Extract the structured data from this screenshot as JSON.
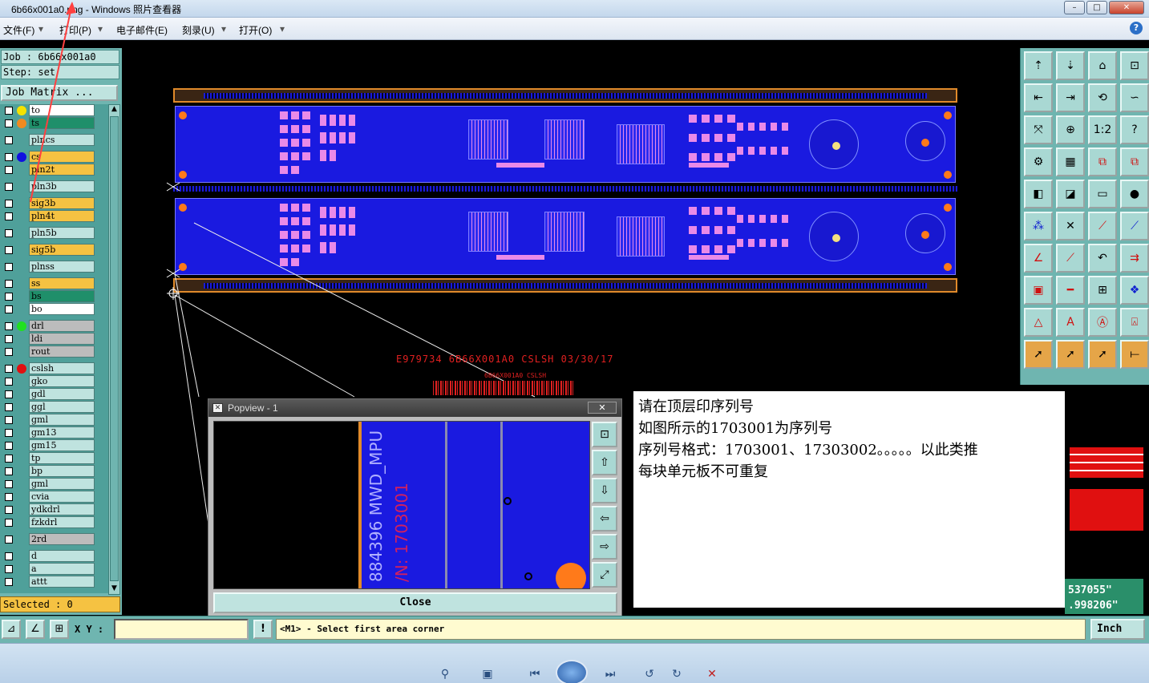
{
  "window": {
    "title": "6b66x001a0.png - Windows 照片查看器",
    "controls": [
      "–",
      "□",
      "✕"
    ]
  },
  "menu": {
    "file": "文件(F)",
    "print": "打印(P)",
    "email": "电子邮件(E)",
    "burn": "刻录(U)",
    "open": "打开(O)",
    "help": "?"
  },
  "job": {
    "job_line": "Job : 6b66x001a0",
    "step_line": "Step: set",
    "matrix_button": "Job Matrix ...",
    "selected": "Selected : 0"
  },
  "layers": [
    {
      "name": "to",
      "dot": "#f5e200",
      "bg": "#ffffff"
    },
    {
      "name": "ts",
      "dot": "#f08a20",
      "bg": "#1f8f6a"
    },
    {
      "name": "plncs",
      "dot": "",
      "bg": "#bfe3df"
    },
    {
      "name": "cs",
      "dot": "#1010e0",
      "bg": "#f5c242"
    },
    {
      "name": "pln2t",
      "dot": "",
      "bg": "#f5c242"
    },
    {
      "name": "pln3b",
      "dot": "",
      "bg": "#bfe3df"
    },
    {
      "name": "sig3b",
      "dot": "",
      "bg": "#f5c242"
    },
    {
      "name": "pln4t",
      "dot": "",
      "bg": "#f5c242"
    },
    {
      "name": "pln5b",
      "dot": "",
      "bg": "#bfe3df"
    },
    {
      "name": "sig5b",
      "dot": "",
      "bg": "#f5c242"
    },
    {
      "name": "plnss",
      "dot": "",
      "bg": "#bfe3df"
    },
    {
      "name": "ss",
      "dot": "",
      "bg": "#f5c242"
    },
    {
      "name": "bs",
      "dot": "",
      "bg": "#1f8f6a"
    },
    {
      "name": "bo",
      "dot": "",
      "bg": "#ffffff"
    },
    {
      "name": "drl",
      "dot": "#20e020",
      "bg": "#bcbcbc"
    },
    {
      "name": "ldi",
      "dot": "",
      "bg": "#bcbcbc"
    },
    {
      "name": "rout",
      "dot": "",
      "bg": "#bcbcbc"
    },
    {
      "name": "cslsh",
      "dot": "#e01010",
      "bg": "#bfe3df"
    },
    {
      "name": "gko",
      "dot": "",
      "bg": "#bfe3df"
    },
    {
      "name": "gdl",
      "dot": "",
      "bg": "#bfe3df"
    },
    {
      "name": "ggl",
      "dot": "",
      "bg": "#bfe3df"
    },
    {
      "name": "gml",
      "dot": "",
      "bg": "#bfe3df"
    },
    {
      "name": "gm13",
      "dot": "",
      "bg": "#bfe3df"
    },
    {
      "name": "gm15",
      "dot": "",
      "bg": "#bfe3df"
    },
    {
      "name": "tp",
      "dot": "",
      "bg": "#bfe3df"
    },
    {
      "name": "bp",
      "dot": "",
      "bg": "#bfe3df"
    },
    {
      "name": "gml",
      "dot": "",
      "bg": "#bfe3df"
    },
    {
      "name": "cvia",
      "dot": "",
      "bg": "#bfe3df"
    },
    {
      "name": "ydkdrl",
      "dot": "",
      "bg": "#bfe3df"
    },
    {
      "name": "fzkdrl",
      "dot": "",
      "bg": "#bfe3df"
    },
    {
      "name": "2rd",
      "dot": "",
      "bg": "#bcbcbc"
    },
    {
      "name": "d",
      "dot": "",
      "bg": "#bfe3df"
    },
    {
      "name": "a",
      "dot": "",
      "bg": "#bfe3df"
    },
    {
      "name": "attt",
      "dot": "",
      "bg": "#bfe3df"
    }
  ],
  "canvas": {
    "silk_line": "E979734   6B66X001A0    CSLSH   03/30/17",
    "small_label": "6B66X001A0  CSLSH"
  },
  "popview": {
    "title": "Popview - 1",
    "close_x": "✕",
    "close_button": "Close",
    "silk_text_1": "884396 MWD_MPU",
    "silk_text_2": "/N: 1703001"
  },
  "note": {
    "line1": "请在顶层印序列号",
    "line2": "如图所示的1703001为序列号",
    "line3": "序列号格式：1703001、17303002。。。。。以此类推",
    "line4": "每块单元板不可重复"
  },
  "coords": {
    "x": "537055\"",
    "y": ".998206\""
  },
  "bottom": {
    "xy_label": "X Y :",
    "xy_value": "",
    "message": "<M1> - Select first area corner",
    "units": "Inch"
  },
  "colors": {
    "panel": "#6fb5b0",
    "pcb_blue": "#1a1ae0",
    "pad_pink": "#e98ae8",
    "orange": "#ff7a1a",
    "silk_red": "#e02020"
  }
}
